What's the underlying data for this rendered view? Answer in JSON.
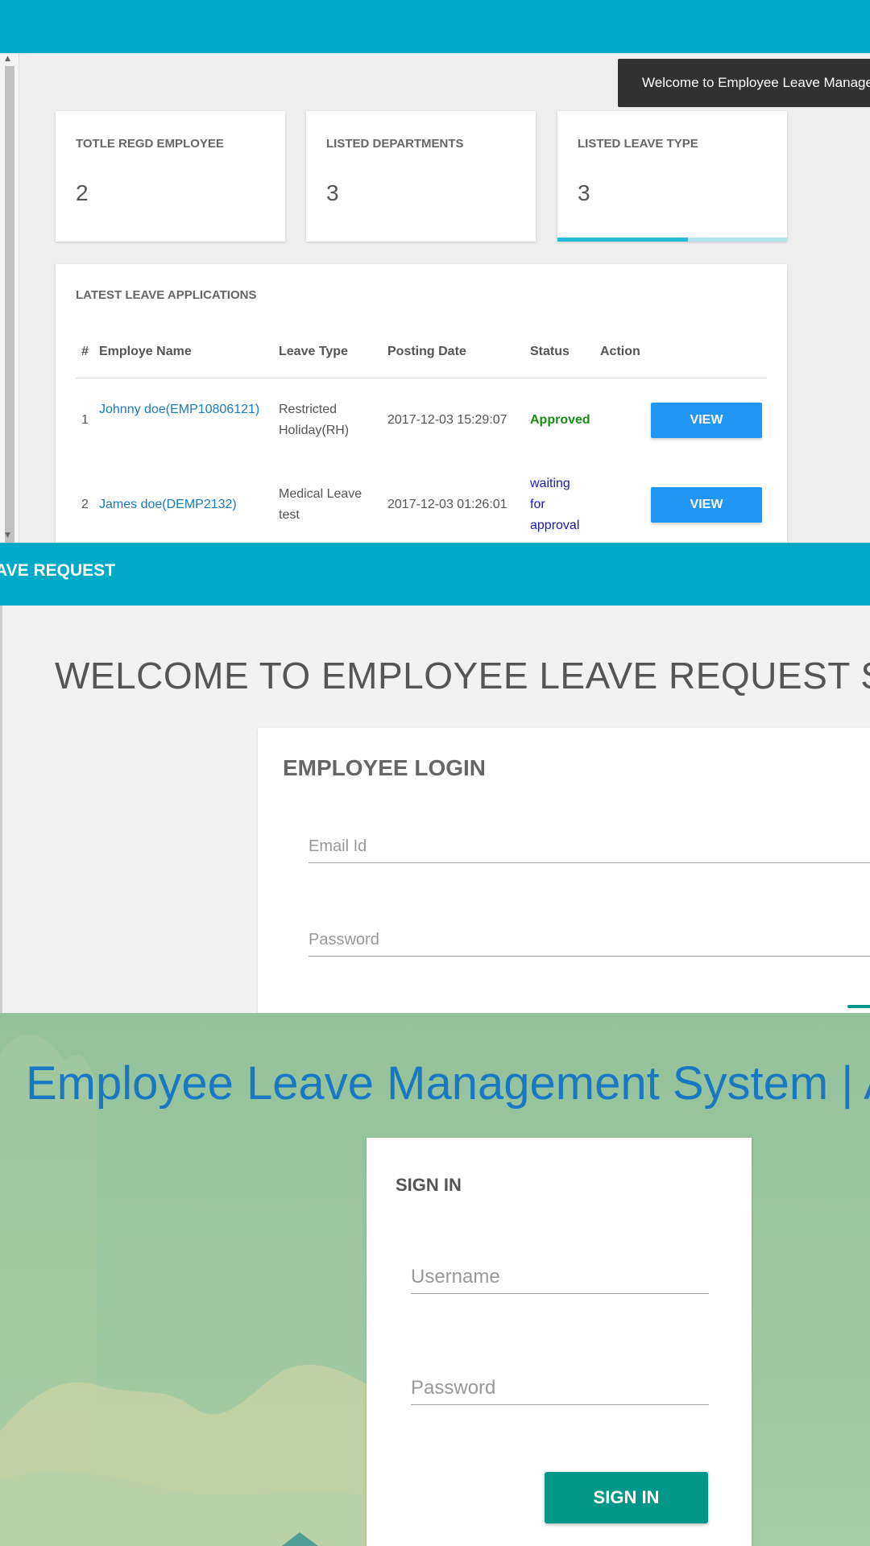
{
  "dashboard": {
    "toast": "Welcome to Employee Leave Management System",
    "stats": [
      {
        "label": "TOTLE REGD EMPLOYEE",
        "value": "2"
      },
      {
        "label": "LISTED DEPARTMENTS",
        "value": "3"
      },
      {
        "label": "LISTED LEAVE TYPE",
        "value": "3"
      }
    ],
    "loader_progress": 0.57,
    "table": {
      "title": "LATEST LEAVE APPLICATIONS",
      "headers": [
        "#",
        "Employe Name",
        "Leave Type",
        "Posting Date",
        "Status",
        "Action"
      ],
      "rows": [
        {
          "num": "1",
          "name": "Johnny doe(EMP10806121)",
          "type": "Restricted Holiday(RH)",
          "date": "2017-12-03 15:29:07",
          "status": "Approved",
          "action": "VIEW"
        },
        {
          "num": "2",
          "name": "James doe(DEMP2132)",
          "type": "Medical Leave test",
          "date": "2017-12-03 01:26:01",
          "status": "waiting for approval",
          "action": "VIEW"
        }
      ]
    }
  },
  "employee_portal": {
    "brand": "AVE REQUEST",
    "welcome": "WELCOME TO EMPLOYEE LEAVE REQUEST SYSTEM",
    "login_title": "EMPLOYEE LOGIN",
    "email_placeholder": "Email Id",
    "password_placeholder": "Password"
  },
  "admin_portal": {
    "title": "Employee Leave Management System | Admin Login",
    "signin_title": "SIGN IN",
    "username_placeholder": "Username",
    "password_placeholder": "Password",
    "signin_button": "SIGN IN"
  },
  "colors": {
    "header": "#00a9c5",
    "view_button": "#2196f3",
    "signin_button": "#009688",
    "title_blue": "#1a78c2",
    "approved": "#1b8a1b",
    "waiting": "#1a1ab8"
  }
}
